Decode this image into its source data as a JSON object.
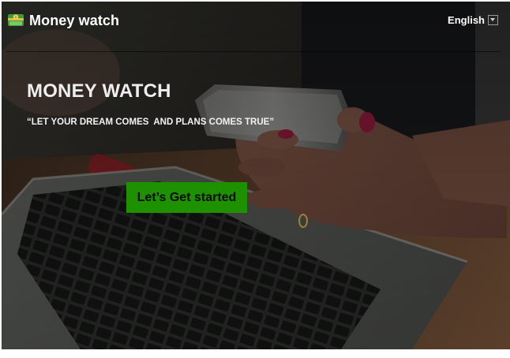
{
  "header": {
    "app_title": "Money watch",
    "language": "English"
  },
  "hero": {
    "title": "MONEY WATCH",
    "tagline": "“LET YOUR DREAM COMES  AND PLANS COMES TRUE”",
    "cta_label": "Let’s Get started"
  },
  "icons": {
    "logo": "money-icon",
    "language_dropdown": "chevron-down-icon"
  },
  "colors": {
    "cta_background": "#1e9100",
    "text": "#ffffff"
  }
}
